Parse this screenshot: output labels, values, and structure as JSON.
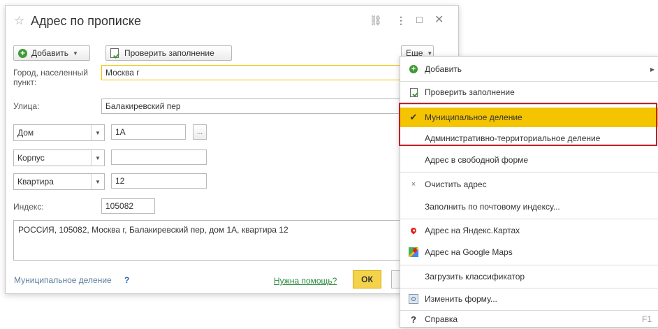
{
  "window": {
    "title": "Адрес по прописке",
    "titlebar_icons": [
      "star-icon",
      "link-icon",
      "more-vertical-icon",
      "maximize-icon",
      "close-icon"
    ]
  },
  "toolbar": {
    "add_label": "Добавить",
    "check_label": "Проверить заполнение",
    "more_label": "Еще"
  },
  "form": {
    "city_label": "Город, населенный пункт:",
    "city_value": "Москва г",
    "street_label": "Улица:",
    "street_value": "Балакиревский пер",
    "house_type": "Дом",
    "house_value": "1А",
    "house_ellipsis": "...",
    "korpus_type": "Корпус",
    "korpus_value": "",
    "flat_type": "Квартира",
    "flat_value": "12",
    "index_label": "Индекс:",
    "index_value": "105082",
    "full_address": "РОССИЯ, 105082, Москва г, Балакиревский пер, дом 1А, квартира 12"
  },
  "footer": {
    "municipal_link": "Муниципальное деление",
    "municipal_help": "?",
    "help_link": "Нужна помощь?",
    "ok_label": "ОК"
  },
  "menu": {
    "items": [
      {
        "label": "Добавить",
        "icon": "plus-circle-icon",
        "submenu": true
      },
      {
        "label": "Проверить заполнение",
        "icon": "check-document-icon"
      },
      {
        "label": "Муниципальное деление",
        "icon": "checkmark-icon",
        "checked": true,
        "highlighted": true
      },
      {
        "label": "Административно-территориальное деление",
        "icon": ""
      },
      {
        "label": "Адрес в свободной форме",
        "icon": ""
      },
      {
        "label": "Очистить адрес",
        "icon": "clear-x-icon"
      },
      {
        "label": "Заполнить по почтовому индексу...",
        "icon": ""
      },
      {
        "label": "Адрес на Яндекс.Картах",
        "icon": "yandex-pin-icon"
      },
      {
        "label": "Адрес на Google Maps",
        "icon": "google-maps-icon"
      },
      {
        "label": "Загрузить классификатор",
        "icon": ""
      },
      {
        "label": "Изменить форму...",
        "icon": "form-settings-icon"
      },
      {
        "label": "Справка",
        "icon": "help-icon",
        "shortcut": "F1"
      }
    ]
  },
  "colors": {
    "highlight": "#f4c400",
    "selection_frame": "#c0202a",
    "ok_button": "#f4d34a",
    "help_link": "#2b8a3e",
    "green_icon": "#3e9b35"
  }
}
